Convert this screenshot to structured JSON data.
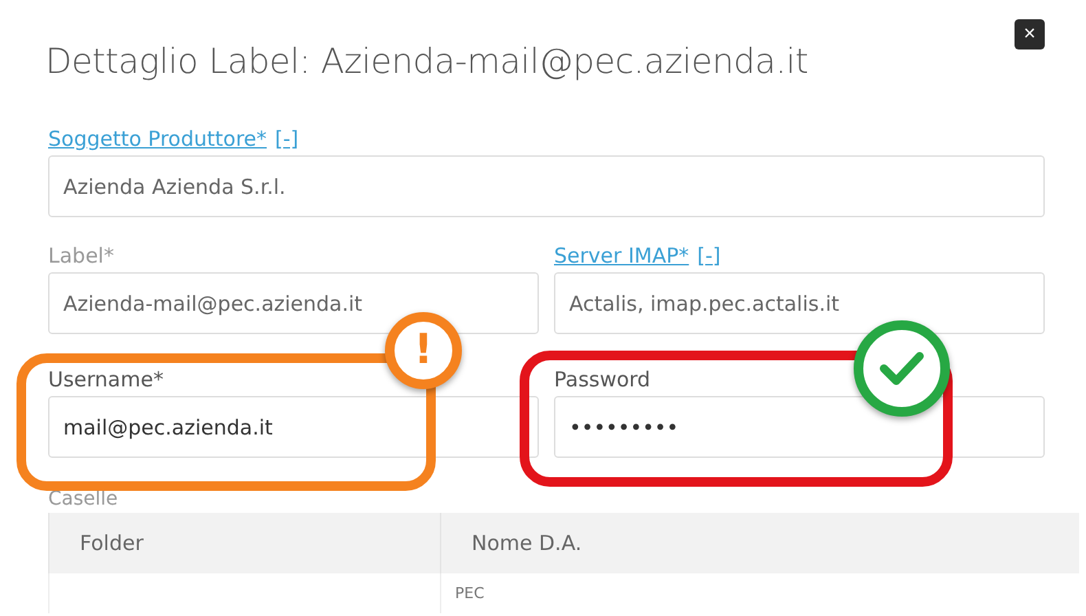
{
  "dialog": {
    "title": "Dettaglio Label: Azienda-mail@pec.azienda.it",
    "close": "×"
  },
  "producer": {
    "label": "Soggetto Produttore*",
    "toggle": "[-]",
    "value": "Azienda Azienda S.r.l."
  },
  "label_field": {
    "label": "Label*",
    "value": "Azienda-mail@pec.azienda.it"
  },
  "server": {
    "label": "Server IMAP*",
    "toggle": "[-]",
    "value": "Actalis, imap.pec.actalis.it"
  },
  "username": {
    "label": "Username*",
    "value": "mail@pec.azienda.it"
  },
  "password": {
    "label": "Password",
    "value": "•••••••••"
  },
  "annotations": [
    {
      "kind": "warning",
      "symbol": "!",
      "color": "#f5821f"
    },
    {
      "kind": "ok",
      "color": "#e3141b"
    }
  ],
  "mailboxes": {
    "label": "Caselle",
    "columns": [
      "Folder",
      "Nome D.A."
    ],
    "rows": [
      [
        "",
        "PEC"
      ]
    ]
  }
}
